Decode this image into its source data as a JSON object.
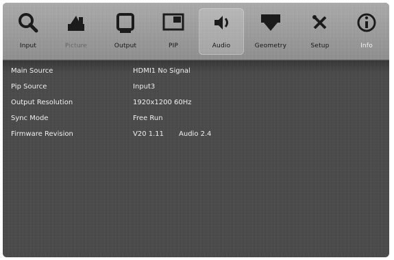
{
  "toolbar": {
    "tabs": [
      {
        "label": "Input",
        "icon": "magnifier-icon",
        "state": "normal"
      },
      {
        "label": "Picture",
        "icon": "picture-icon",
        "state": "disabled"
      },
      {
        "label": "Output",
        "icon": "output-icon",
        "state": "normal"
      },
      {
        "label": "PIP",
        "icon": "pip-icon",
        "state": "normal"
      },
      {
        "label": "Audio",
        "icon": "speaker-icon",
        "state": "active"
      },
      {
        "label": "Geometry",
        "icon": "geometry-icon",
        "state": "normal"
      },
      {
        "label": "Setup",
        "icon": "tools-icon",
        "state": "normal"
      },
      {
        "label": "Info",
        "icon": "info-icon",
        "state": "highlight"
      }
    ]
  },
  "info": {
    "rows": [
      {
        "key": "Main Source",
        "value": "HDMI1 No Signal"
      },
      {
        "key": "Pip Source",
        "value": "Input3"
      },
      {
        "key": "Output Resolution",
        "value": "1920x1200 60Hz"
      },
      {
        "key": "Sync Mode",
        "value": "Free Run"
      },
      {
        "key": "Firmware Revision",
        "value": "V20 1.11",
        "value2": "Audio 2.4"
      }
    ]
  }
}
